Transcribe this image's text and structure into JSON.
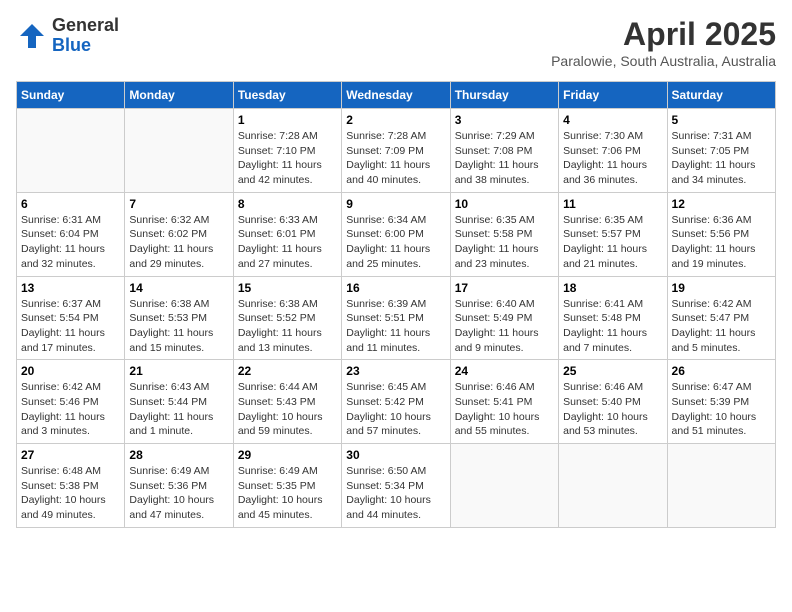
{
  "header": {
    "logo_line1": "General",
    "logo_line2": "Blue",
    "month_title": "April 2025",
    "location": "Paralowie, South Australia, Australia"
  },
  "days_of_week": [
    "Sunday",
    "Monday",
    "Tuesday",
    "Wednesday",
    "Thursday",
    "Friday",
    "Saturday"
  ],
  "weeks": [
    [
      {
        "day": null
      },
      {
        "day": null
      },
      {
        "day": "1",
        "sunrise": "Sunrise: 7:28 AM",
        "sunset": "Sunset: 7:10 PM",
        "daylight": "Daylight: 11 hours and 42 minutes."
      },
      {
        "day": "2",
        "sunrise": "Sunrise: 7:28 AM",
        "sunset": "Sunset: 7:09 PM",
        "daylight": "Daylight: 11 hours and 40 minutes."
      },
      {
        "day": "3",
        "sunrise": "Sunrise: 7:29 AM",
        "sunset": "Sunset: 7:08 PM",
        "daylight": "Daylight: 11 hours and 38 minutes."
      },
      {
        "day": "4",
        "sunrise": "Sunrise: 7:30 AM",
        "sunset": "Sunset: 7:06 PM",
        "daylight": "Daylight: 11 hours and 36 minutes."
      },
      {
        "day": "5",
        "sunrise": "Sunrise: 7:31 AM",
        "sunset": "Sunset: 7:05 PM",
        "daylight": "Daylight: 11 hours and 34 minutes."
      }
    ],
    [
      {
        "day": "6",
        "sunrise": "Sunrise: 6:31 AM",
        "sunset": "Sunset: 6:04 PM",
        "daylight": "Daylight: 11 hours and 32 minutes."
      },
      {
        "day": "7",
        "sunrise": "Sunrise: 6:32 AM",
        "sunset": "Sunset: 6:02 PM",
        "daylight": "Daylight: 11 hours and 29 minutes."
      },
      {
        "day": "8",
        "sunrise": "Sunrise: 6:33 AM",
        "sunset": "Sunset: 6:01 PM",
        "daylight": "Daylight: 11 hours and 27 minutes."
      },
      {
        "day": "9",
        "sunrise": "Sunrise: 6:34 AM",
        "sunset": "Sunset: 6:00 PM",
        "daylight": "Daylight: 11 hours and 25 minutes."
      },
      {
        "day": "10",
        "sunrise": "Sunrise: 6:35 AM",
        "sunset": "Sunset: 5:58 PM",
        "daylight": "Daylight: 11 hours and 23 minutes."
      },
      {
        "day": "11",
        "sunrise": "Sunrise: 6:35 AM",
        "sunset": "Sunset: 5:57 PM",
        "daylight": "Daylight: 11 hours and 21 minutes."
      },
      {
        "day": "12",
        "sunrise": "Sunrise: 6:36 AM",
        "sunset": "Sunset: 5:56 PM",
        "daylight": "Daylight: 11 hours and 19 minutes."
      }
    ],
    [
      {
        "day": "13",
        "sunrise": "Sunrise: 6:37 AM",
        "sunset": "Sunset: 5:54 PM",
        "daylight": "Daylight: 11 hours and 17 minutes."
      },
      {
        "day": "14",
        "sunrise": "Sunrise: 6:38 AM",
        "sunset": "Sunset: 5:53 PM",
        "daylight": "Daylight: 11 hours and 15 minutes."
      },
      {
        "day": "15",
        "sunrise": "Sunrise: 6:38 AM",
        "sunset": "Sunset: 5:52 PM",
        "daylight": "Daylight: 11 hours and 13 minutes."
      },
      {
        "day": "16",
        "sunrise": "Sunrise: 6:39 AM",
        "sunset": "Sunset: 5:51 PM",
        "daylight": "Daylight: 11 hours and 11 minutes."
      },
      {
        "day": "17",
        "sunrise": "Sunrise: 6:40 AM",
        "sunset": "Sunset: 5:49 PM",
        "daylight": "Daylight: 11 hours and 9 minutes."
      },
      {
        "day": "18",
        "sunrise": "Sunrise: 6:41 AM",
        "sunset": "Sunset: 5:48 PM",
        "daylight": "Daylight: 11 hours and 7 minutes."
      },
      {
        "day": "19",
        "sunrise": "Sunrise: 6:42 AM",
        "sunset": "Sunset: 5:47 PM",
        "daylight": "Daylight: 11 hours and 5 minutes."
      }
    ],
    [
      {
        "day": "20",
        "sunrise": "Sunrise: 6:42 AM",
        "sunset": "Sunset: 5:46 PM",
        "daylight": "Daylight: 11 hours and 3 minutes."
      },
      {
        "day": "21",
        "sunrise": "Sunrise: 6:43 AM",
        "sunset": "Sunset: 5:44 PM",
        "daylight": "Daylight: 11 hours and 1 minute."
      },
      {
        "day": "22",
        "sunrise": "Sunrise: 6:44 AM",
        "sunset": "Sunset: 5:43 PM",
        "daylight": "Daylight: 10 hours and 59 minutes."
      },
      {
        "day": "23",
        "sunrise": "Sunrise: 6:45 AM",
        "sunset": "Sunset: 5:42 PM",
        "daylight": "Daylight: 10 hours and 57 minutes."
      },
      {
        "day": "24",
        "sunrise": "Sunrise: 6:46 AM",
        "sunset": "Sunset: 5:41 PM",
        "daylight": "Daylight: 10 hours and 55 minutes."
      },
      {
        "day": "25",
        "sunrise": "Sunrise: 6:46 AM",
        "sunset": "Sunset: 5:40 PM",
        "daylight": "Daylight: 10 hours and 53 minutes."
      },
      {
        "day": "26",
        "sunrise": "Sunrise: 6:47 AM",
        "sunset": "Sunset: 5:39 PM",
        "daylight": "Daylight: 10 hours and 51 minutes."
      }
    ],
    [
      {
        "day": "27",
        "sunrise": "Sunrise: 6:48 AM",
        "sunset": "Sunset: 5:38 PM",
        "daylight": "Daylight: 10 hours and 49 minutes."
      },
      {
        "day": "28",
        "sunrise": "Sunrise: 6:49 AM",
        "sunset": "Sunset: 5:36 PM",
        "daylight": "Daylight: 10 hours and 47 minutes."
      },
      {
        "day": "29",
        "sunrise": "Sunrise: 6:49 AM",
        "sunset": "Sunset: 5:35 PM",
        "daylight": "Daylight: 10 hours and 45 minutes."
      },
      {
        "day": "30",
        "sunrise": "Sunrise: 6:50 AM",
        "sunset": "Sunset: 5:34 PM",
        "daylight": "Daylight: 10 hours and 44 minutes."
      },
      {
        "day": null
      },
      {
        "day": null
      },
      {
        "day": null
      }
    ]
  ]
}
